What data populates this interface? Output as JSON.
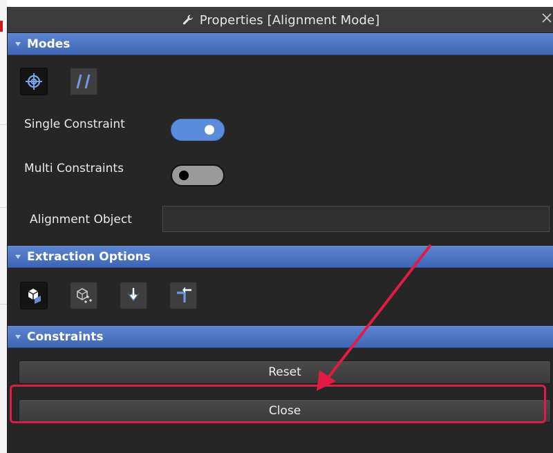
{
  "window": {
    "title": "Properties [Alignment Mode]",
    "title_icon": "wrench-icon",
    "close_icon": "close-icon"
  },
  "sections": {
    "modes": {
      "label": "Modes",
      "buttons": [
        {
          "icon": "target-crosshair-icon",
          "active": true
        },
        {
          "icon": "parallel-lines-icon",
          "active": false
        }
      ],
      "single_constraint": {
        "label": "Single Constraint",
        "on": true
      },
      "multi_constraints": {
        "label": "Multi Constraints",
        "on": false
      },
      "alignment_object": {
        "label": "Alignment Object",
        "value": ""
      }
    },
    "extraction_options": {
      "label": "Extraction Options",
      "buttons": [
        {
          "icon": "cube-select-icon",
          "active": true
        },
        {
          "icon": "cube-points-icon",
          "active": false
        },
        {
          "icon": "surface-point-icon",
          "active": false
        },
        {
          "icon": "corner-arrow-icon",
          "active": false
        }
      ]
    },
    "constraints": {
      "label": "Constraints",
      "reset_label": "Reset",
      "close_label": "Close"
    }
  },
  "annotation": {
    "color": "#e21b45",
    "target": "close-button"
  },
  "colors": {
    "header_blue": "#4a73c2",
    "panel_bg": "#262626",
    "toggle_on": "#5b8bdb"
  }
}
